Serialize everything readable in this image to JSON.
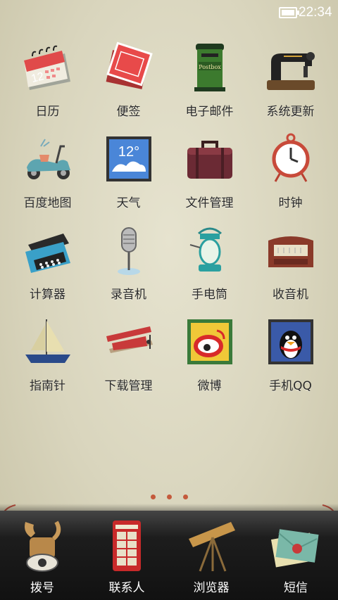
{
  "status_bar": {
    "time": "22:34",
    "battery_level": 1.0
  },
  "apps": [
    {
      "label": "日历",
      "icon": "calendar-icon",
      "calendar_day": "12"
    },
    {
      "label": "便签",
      "icon": "notepad-icon"
    },
    {
      "label": "电子邮件",
      "icon": "postbox-icon",
      "postbox_text": "Postbox"
    },
    {
      "label": "系统更新",
      "icon": "sewing-machine-icon"
    },
    {
      "label": "百度地图",
      "icon": "scooter-icon"
    },
    {
      "label": "天气",
      "icon": "weather-stamp-icon",
      "temperature": "12°"
    },
    {
      "label": "文件管理",
      "icon": "suitcase-icon"
    },
    {
      "label": "时钟",
      "icon": "clock-icon"
    },
    {
      "label": "计算器",
      "icon": "typewriter-icon"
    },
    {
      "label": "录音机",
      "icon": "microphone-icon"
    },
    {
      "label": "手电筒",
      "icon": "lantern-icon"
    },
    {
      "label": "收音机",
      "icon": "radio-icon"
    },
    {
      "label": "指南针",
      "icon": "sailboat-icon"
    },
    {
      "label": "下载管理",
      "icon": "biplane-icon"
    },
    {
      "label": "微博",
      "icon": "weibo-stamp-icon"
    },
    {
      "label": "手机QQ",
      "icon": "qq-penguin-stamp-icon"
    }
  ],
  "page_indicator": {
    "pages": 3
  },
  "dock": [
    {
      "label": "拨号",
      "icon": "vintage-phone-icon"
    },
    {
      "label": "联系人",
      "icon": "phone-booth-icon"
    },
    {
      "label": "浏览器",
      "icon": "telescope-icon"
    },
    {
      "label": "短信",
      "icon": "envelope-icon"
    }
  ]
}
